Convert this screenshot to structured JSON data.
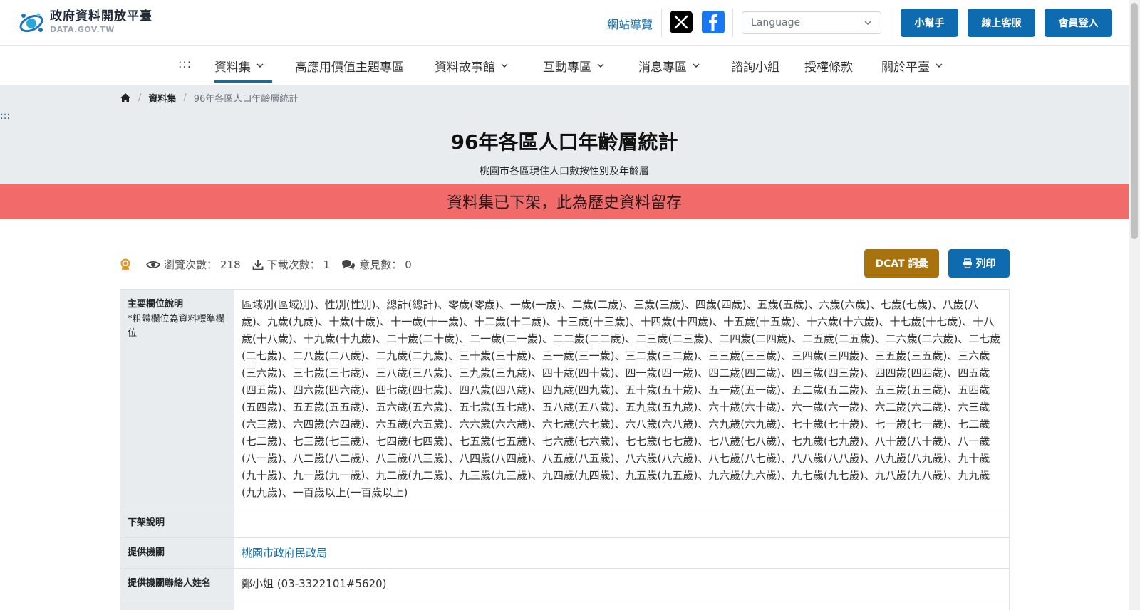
{
  "header": {
    "logo_title": "政府資料開放平臺",
    "logo_sub": "DATA.GOV.TW",
    "sitemap": "網站導覽",
    "language_placeholder": "Language",
    "helper_btn": "小幫手",
    "service_btn": "線上客服",
    "login_btn": "會員登入"
  },
  "nav": {
    "accesskey": ":::",
    "items": [
      "資料集",
      "高應用價值主題專區",
      "資料故事館",
      "互動專區",
      "消息專區",
      "諮詢小組",
      "授權條款",
      "關於平臺"
    ]
  },
  "breadcrumb": {
    "level1": "資料集",
    "current": "96年各區人口年齡層統計"
  },
  "left_accesskey": ":::",
  "page": {
    "title": "96年各區人口年齡層統計",
    "subtitle": "桃園市各區現住人口數按性別及年齡層",
    "alert": "資料集已下架，此為歷史資料留存"
  },
  "stats": {
    "views_label": "瀏覽次數：",
    "views": "218",
    "downloads_label": "下載次數：",
    "downloads": "1",
    "comments_label": "意見數：",
    "comments": "0"
  },
  "actions": {
    "dcat": "DCAT 詞彙",
    "print": "列印"
  },
  "table": {
    "fields_label": "主要欄位說明",
    "fields_note": "*粗體欄位為資料標準欄位",
    "fields_value": "區域別(區域別)、性別(性別)、總計(總計)、零歲(零歲)、一歲(一歲)、二歲(二歲)、三歲(三歲)、四歲(四歲)、五歲(五歲)、六歲(六歲)、七歲(七歲)、八歲(八歲)、九歲(九歲)、十歲(十歲)、十一歲(十一歲)、十二歲(十二歲)、十三歲(十三歲)、十四歲(十四歲)、十五歲(十五歲)、十六歲(十六歲)、十七歲(十七歲)、十八歲(十八歲)、十九歲(十九歲)、二十歲(二十歲)、二一歲(二一歲)、二二歲(二二歲)、二三歲(二三歲)、二四歲(二四歲)、二五歲(二五歲)、二六歲(二六歲)、二七歲(二七歲)、二八歲(二八歲)、二九歲(二九歲)、三十歲(三十歲)、三一歲(三一歲)、三二歲(三二歲)、三三歲(三三歲)、三四歲(三四歲)、三五歲(三五歲)、三六歲(三六歲)、三七歲(三七歲)、三八歲(三八歲)、三九歲(三九歲)、四十歲(四十歲)、四一歲(四一歲)、四二歲(四二歲)、四三歲(四三歲)、四四歲(四四歲)、四五歲(四五歲)、四六歲(四六歲)、四七歲(四七歲)、四八歲(四八歲)、四九歲(四九歲)、五十歲(五十歲)、五一歲(五一歲)、五二歲(五二歲)、五三歲(五三歲)、五四歲(五四歲)、五五歲(五五歲)、五六歲(五六歲)、五七歲(五七歲)、五八歲(五八歲)、五九歲(五九歲)、六十歲(六十歲)、六一歲(六一歲)、六二歲(六二歲)、六三歲(六三歲)、六四歲(六四歲)、六五歲(六五歲)、六六歲(六六歲)、六七歲(六七歲)、六八歲(六八歲)、六九歲(六九歲)、七十歲(七十歲)、七一歲(七一歲)、七二歲(七二歲)、七三歲(七三歲)、七四歲(七四歲)、七五歲(七五歲)、七六歲(七六歲)、七七歲(七七歲)、七八歲(七八歲)、七九歲(七九歲)、八十歲(八十歲)、八一歲(八一歲)、八二歲(八二歲)、八三歲(八三歲)、八四歲(八四歲)、八五歲(八五歲)、八六歲(八六歲)、八七歲(八七歲)、八八歲(八八歲)、八九歲(八九歲)、九十歲(九十歲)、九一歲(九一歲)、九二歲(九二歲)、九三歲(九三歲)、九四歲(九四歲)、九五歲(九五歲)、九六歲(九六歲)、九七歲(九七歲)、九八歲(九八歲)、九九歲(九九歲)、一百歲以上(一百歲以上)",
    "removal_label": "下架說明",
    "removal_value": "",
    "provider_label": "提供機關",
    "provider_value": "桃園市政府民政局",
    "contact_label": "提供機關聯絡人姓名",
    "contact_value": "鄭小姐 (03-3322101#5620)"
  },
  "colors": {
    "primary": "#0f6bb0",
    "alert_bg": "#f26b6b",
    "dcat_bg": "#a8730f",
    "band_bg": "#e9ecef"
  }
}
